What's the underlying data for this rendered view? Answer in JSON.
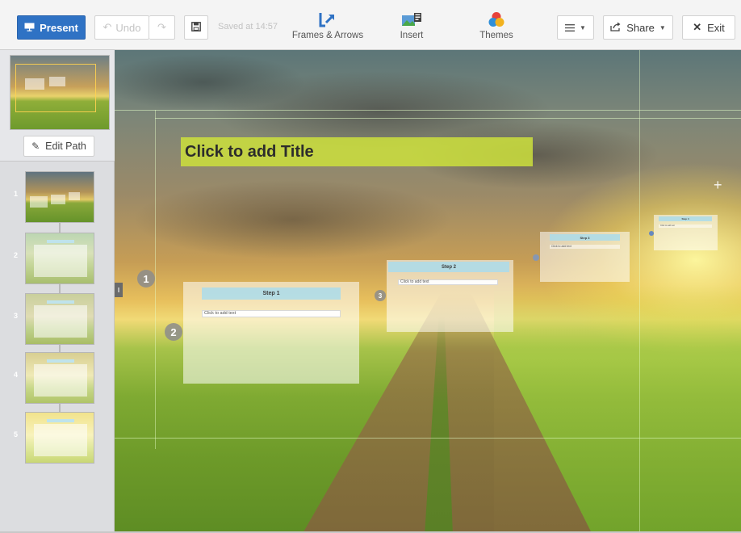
{
  "toolbar": {
    "present_label": "Present",
    "undo_label": "Undo",
    "saved_text": "Saved at 14:57",
    "frames_label": "Frames & Arrows",
    "insert_label": "Insert",
    "themes_label": "Themes",
    "share_label": "Share",
    "exit_label": "Exit"
  },
  "sidebar": {
    "edit_path_label": "Edit Path",
    "slides": [
      {
        "number": "1"
      },
      {
        "number": "2"
      },
      {
        "number": "3"
      },
      {
        "number": "4"
      },
      {
        "number": "5"
      }
    ]
  },
  "canvas": {
    "title_placeholder": "Click to add Title",
    "path_numbers": [
      "1",
      "2",
      "3"
    ],
    "frames": [
      {
        "header": "Step 1",
        "field": "Click to add text"
      },
      {
        "header": "Step 2",
        "field": "Click to add text"
      },
      {
        "header": "Step 3",
        "field": "Click to add text"
      },
      {
        "header": "Step 4",
        "field": "Click to add text"
      }
    ]
  },
  "colors": {
    "present_button": "#2f72c4",
    "title_highlight": "#cde13c",
    "frame_header": "#aadceb"
  }
}
